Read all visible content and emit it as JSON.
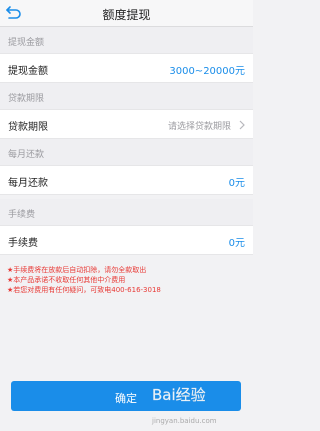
{
  "nav": {
    "title": "额度提现"
  },
  "sections": [
    {
      "header": "提现金额",
      "label": "提现金额",
      "value": "3000~20000元"
    },
    {
      "header": "贷款期限",
      "label": "贷款期限",
      "placeholder": "请选择贷款期限"
    },
    {
      "header": "每月还款",
      "label": "每月还款",
      "value": "0元"
    },
    {
      "header": "手续费",
      "label": "手续费",
      "value": "0元"
    }
  ],
  "notes": [
    "★手续费将在放款后自动扣除，请勿全款取出",
    "★本产品承诺不收取任何其他中介费用",
    "★若您对费用有任何疑问，可致电400-616-3018"
  ],
  "confirm_label": "确定",
  "watermark": {
    "text": "Bai经验",
    "url": "jingyan.baidu.com"
  },
  "colors": {
    "accent": "#1a8de9",
    "note": "#e83a36"
  }
}
